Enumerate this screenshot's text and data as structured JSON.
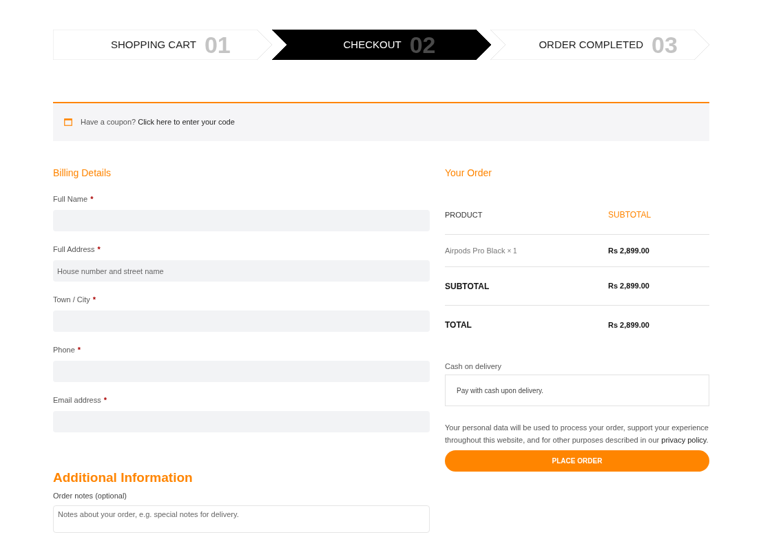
{
  "steps": [
    {
      "label": "SHOPPING CART",
      "number": "01",
      "selected": false
    },
    {
      "label": "CHECKOUT",
      "number": "02",
      "selected": true
    },
    {
      "label": "ORDER COMPLETED",
      "number": "03",
      "selected": false
    }
  ],
  "coupon": {
    "text": "Have a coupon?",
    "link": "Click here to enter your code"
  },
  "billing": {
    "title": "Billing Details",
    "fields": [
      {
        "label": "Full Name",
        "required_mark": "*"
      },
      {
        "label": "Full Address",
        "required_mark": "*",
        "placeholder": "House number and street name"
      },
      {
        "label": "Town / City",
        "required_mark": "*"
      },
      {
        "label": "Phone",
        "required_mark": "*"
      },
      {
        "label": "Email address",
        "required_mark": "*"
      }
    ]
  },
  "additional": {
    "title": "Additional Information",
    "notes_label": "Order notes (optional)",
    "notes_placeholder": "Notes about your order, e.g. special notes for delivery."
  },
  "order": {
    "title": "Your Order",
    "columns": [
      "PRODUCT",
      "SUBTOTAL"
    ],
    "items": [
      {
        "name": "Airpods Pro Black",
        "quantity": "× 1",
        "price": "Rs 2,899.00"
      }
    ],
    "totals": [
      {
        "label": "SUBTOTAL",
        "value": "Rs 2,899.00"
      },
      {
        "label": "TOTAL",
        "value": "Rs 2,899.00"
      }
    ]
  },
  "payment": {
    "method": "Cash on delivery",
    "description": "Pay with cash upon delivery."
  },
  "privacy": {
    "text": "Your personal data will be used to process your order, support your experience throughout this website, and for other purposes described in our",
    "link": "privacy policy",
    "end": "."
  },
  "place_order": "PLACE ORDER"
}
